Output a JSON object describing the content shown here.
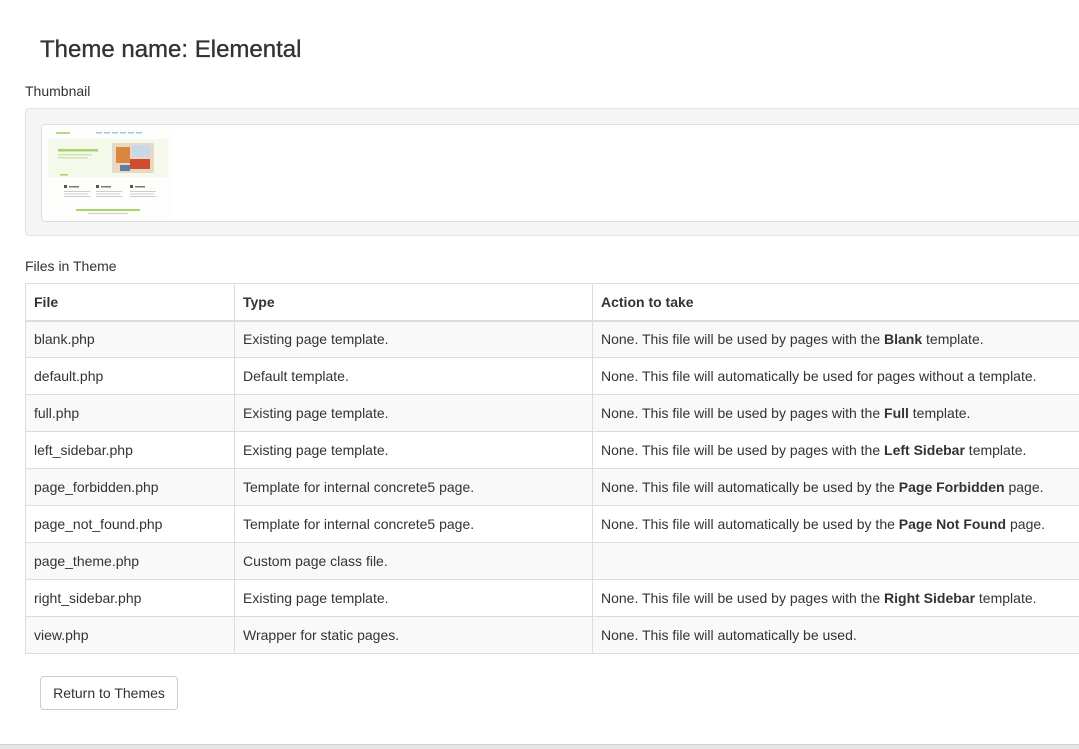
{
  "page": {
    "title": "Theme name: Elemental"
  },
  "thumbnail": {
    "label": "Thumbnail",
    "image_name": "theme-thumbnail"
  },
  "files_section": {
    "label": "Files in Theme",
    "columns": [
      "File",
      "Type",
      "Action to take"
    ],
    "rows": [
      {
        "file": "blank.php",
        "type": "Existing page template.",
        "action_pre": "None. This file will be used by pages with the ",
        "action_bold": "Blank",
        "action_post": " template."
      },
      {
        "file": "default.php",
        "type": "Default template.",
        "action_pre": "None. This file will automatically be used for pages without a template.",
        "action_bold": "",
        "action_post": ""
      },
      {
        "file": "full.php",
        "type": "Existing page template.",
        "action_pre": "None. This file will be used by pages with the ",
        "action_bold": "Full",
        "action_post": " template."
      },
      {
        "file": "left_sidebar.php",
        "type": "Existing page template.",
        "action_pre": "None. This file will be used by pages with the ",
        "action_bold": "Left Sidebar",
        "action_post": " template."
      },
      {
        "file": "page_forbidden.php",
        "type": "Template for internal concrete5 page.",
        "action_pre": "None. This file will automatically be used by the ",
        "action_bold": "Page Forbidden",
        "action_post": " page."
      },
      {
        "file": "page_not_found.php",
        "type": "Template for internal concrete5 page.",
        "action_pre": "None. This file will automatically be used by the ",
        "action_bold": "Page Not Found",
        "action_post": " page."
      },
      {
        "file": "page_theme.php",
        "type": "Custom page class file.",
        "action_pre": "",
        "action_bold": "",
        "action_post": ""
      },
      {
        "file": "right_sidebar.php",
        "type": "Existing page template.",
        "action_pre": "None. This file will be used by pages with the ",
        "action_bold": "Right Sidebar",
        "action_post": " template."
      },
      {
        "file": "view.php",
        "type": "Wrapper for static pages.",
        "action_pre": "None. This file will automatically be used.",
        "action_bold": "",
        "action_post": ""
      }
    ]
  },
  "actions": {
    "return_label": "Return to Themes"
  },
  "colors": {
    "text": "#333333",
    "border": "#dddddd",
    "stripe": "#f9f9f9",
    "well": "#f5f5f5",
    "accent_green": "#8cc63f"
  }
}
